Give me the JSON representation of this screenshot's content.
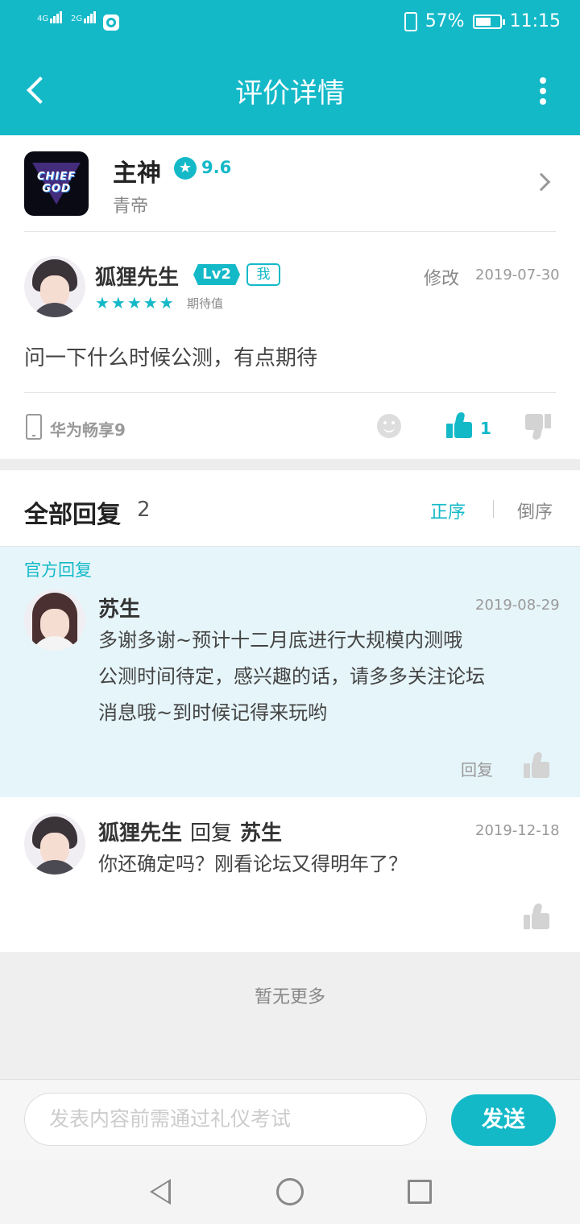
{
  "status_bar": {
    "signal_1": "4G",
    "signal_2": "2G",
    "battery": "57%",
    "time": "11:15"
  },
  "header": {
    "title": "评价详情"
  },
  "game": {
    "name": "主神",
    "score": "9.6",
    "developer": "青帝",
    "icon_text": "CHIEF GOD"
  },
  "review": {
    "user": "狐狸先生",
    "level": "Lv2",
    "me_tag": "我",
    "stars": "★★★★★",
    "rating_label": "期待值",
    "edit_label": "修改",
    "date": "2019-07-30",
    "text": "问一下什么时候公测，有点期待",
    "device": "华为畅享9",
    "likes": "1"
  },
  "replies": {
    "title": "全部回复",
    "count": "2",
    "sort_asc": "正序",
    "sort_desc": "倒序",
    "official_label": "官方回复",
    "items": [
      {
        "user": "苏生",
        "date": "2019-08-29",
        "lines": [
          "多谢多谢~预计十二月底进行大规模内测哦",
          "公测时间待定，感兴趣的话，请多多关注论坛",
          "消息哦~到时候记得来玩哟"
        ],
        "reply_label": "回复"
      },
      {
        "user": "狐狸先生",
        "reply_word": "回复",
        "target": "苏生",
        "date": "2019-12-18",
        "text": "你还确定吗？刚看论坛又得明年了？"
      }
    ],
    "no_more": "暂无更多"
  },
  "composer": {
    "placeholder": "发表内容前需通过礼仪考试",
    "send": "发送"
  },
  "colors": {
    "accent": "#14b9c8",
    "official_bg": "#e6f5f9"
  }
}
